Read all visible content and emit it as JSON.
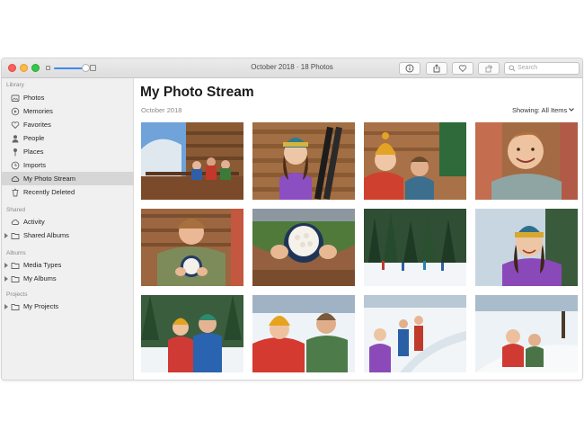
{
  "window": {
    "title": "October 2018 · 18 Photos"
  },
  "toolbar": {
    "buttons": [
      {
        "icon": "info-icon"
      },
      {
        "icon": "share-icon"
      },
      {
        "icon": "heart-icon"
      },
      {
        "icon": "rotate-icon"
      }
    ],
    "search_placeholder": "Search"
  },
  "sidebar": {
    "library_header": "Library",
    "library_items": [
      {
        "label": "Photos",
        "icon": "photos-icon"
      },
      {
        "label": "Memories",
        "icon": "memories-icon"
      },
      {
        "label": "Favorites",
        "icon": "heart-icon"
      },
      {
        "label": "People",
        "icon": "person-icon"
      },
      {
        "label": "Places",
        "icon": "pin-icon"
      },
      {
        "label": "Imports",
        "icon": "clock-icon"
      },
      {
        "label": "My Photo Stream",
        "icon": "cloud-icon",
        "selected": true
      },
      {
        "label": "Recently Deleted",
        "icon": "trash-icon"
      }
    ],
    "shared_header": "Shared",
    "shared_items": [
      {
        "label": "Activity",
        "icon": "cloud-icon"
      },
      {
        "label": "Shared Albums",
        "icon": "folder-icon"
      }
    ],
    "albums_header": "Albums",
    "album_items": [
      {
        "label": "Media Types",
        "icon": "folder-icon"
      },
      {
        "label": "My Albums",
        "icon": "folder-icon"
      }
    ],
    "projects_header": "Projects",
    "project_items": [
      {
        "label": "My Projects",
        "icon": "folder-icon"
      }
    ]
  },
  "main": {
    "title": "My Photo Stream",
    "date": "October 2018",
    "showing_label": "Showing:",
    "showing_value": "All Items"
  },
  "colors": {
    "accent": "#3b8af0",
    "selection": "#d6d6d6",
    "sidebar_bg": "#f0f0f0"
  },
  "photos": [
    {
      "subject": "family on wooden deck"
    },
    {
      "subject": "girl with skis"
    },
    {
      "subject": "two kids in beanies"
    },
    {
      "subject": "smiling boy closeup"
    },
    {
      "subject": "boy holding marshmallow mug"
    },
    {
      "subject": "marshmallow mug overhead"
    },
    {
      "subject": "skiers among pine trees"
    },
    {
      "subject": "girl in striped beanie"
    },
    {
      "subject": "couple in forest snow"
    },
    {
      "subject": "two kids in snow"
    },
    {
      "subject": "family walking in snow"
    },
    {
      "subject": "kids sledding"
    }
  ]
}
